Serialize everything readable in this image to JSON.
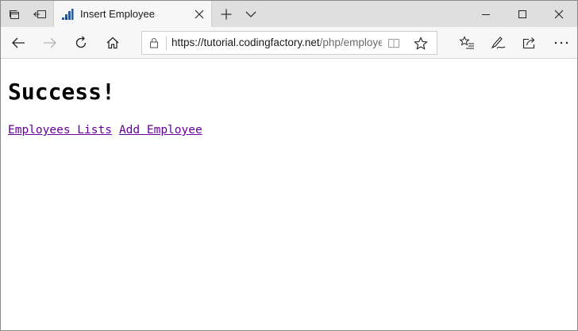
{
  "tab": {
    "title": "Insert Employee"
  },
  "addressbar": {
    "url_host": "https://tutorial.codingfactory.net",
    "url_path": "/php/employee"
  },
  "page": {
    "heading": "Success!",
    "links": [
      {
        "label": "Employees Lists"
      },
      {
        "label": "Add Employee"
      }
    ]
  },
  "colors": {
    "link_visited": "#660099",
    "tab_bar": "#dfdfdf",
    "toolbar": "#f7f7f7"
  },
  "icons": {
    "tab_bar": [
      "tabs-aside-icon",
      "tab-preview-icon",
      "new-tab-icon",
      "tab-list-chevron-icon"
    ],
    "window": [
      "minimize-icon",
      "maximize-icon",
      "close-window-icon"
    ],
    "nav": [
      "back-icon",
      "forward-icon",
      "refresh-icon",
      "home-icon",
      "lock-icon",
      "reading-view-icon",
      "favorite-star-icon",
      "favorites-hub-icon",
      "pen-icon",
      "share-icon",
      "more-icon"
    ]
  }
}
